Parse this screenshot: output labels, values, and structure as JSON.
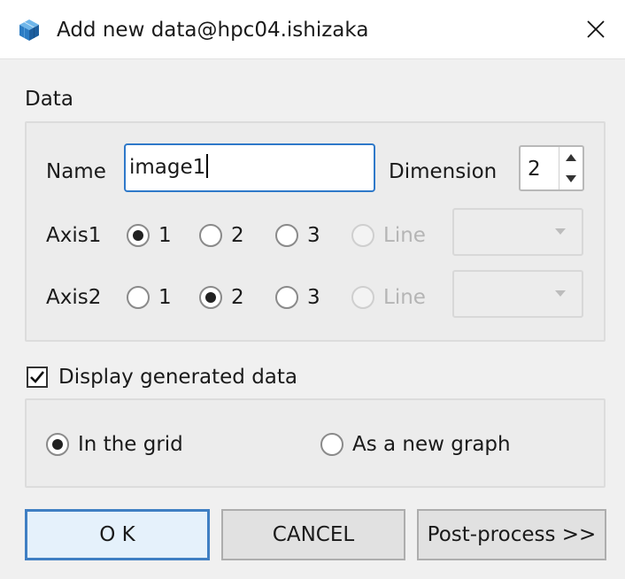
{
  "window": {
    "title": "Add new data@hpc04.ishizaka",
    "icon": "cube-app-icon",
    "close_icon": "close-icon"
  },
  "data_section": {
    "label": "Data",
    "name_label": "Name",
    "name_value": "image1",
    "dimension_label": "Dimension",
    "dimension_value": "2",
    "axes": [
      {
        "label": "Axis1",
        "options": [
          "1",
          "2",
          "3",
          "Line"
        ],
        "selected": "1",
        "disabled_options": [
          "Line"
        ],
        "combo_value": ""
      },
      {
        "label": "Axis2",
        "options": [
          "1",
          "2",
          "3",
          "Line"
        ],
        "selected": "2",
        "disabled_options": [
          "Line"
        ],
        "combo_value": ""
      }
    ]
  },
  "display_section": {
    "checkbox_label": "Display generated data",
    "checked": true,
    "options": [
      "In the grid",
      "As a new graph"
    ],
    "selected": "In the grid"
  },
  "buttons": {
    "ok": "O K",
    "cancel": "CANCEL",
    "post_process": "Post-process >>"
  },
  "colors": {
    "accent": "#2f79c9",
    "background": "#f0f0f0",
    "disabled_text": "#b5b5b5"
  }
}
